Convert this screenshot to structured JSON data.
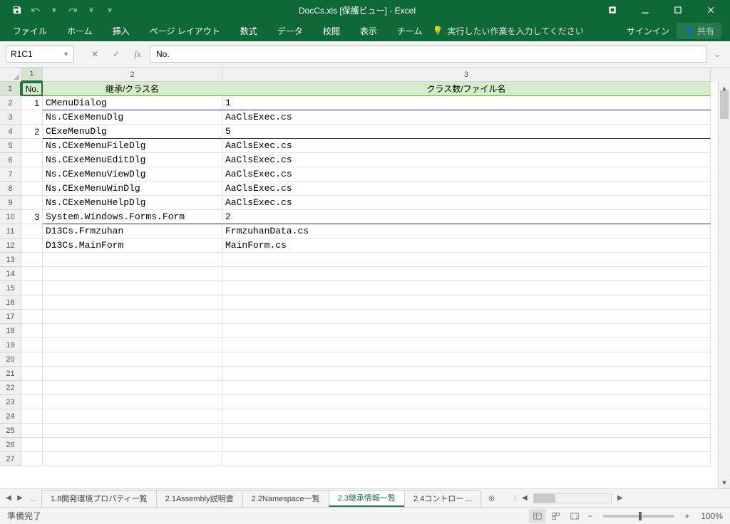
{
  "title": "DocCs.xls [保護ビュー] - Excel",
  "ribbon": {
    "file": "ファイル",
    "home": "ホーム",
    "insert": "挿入",
    "pagelayout": "ページ レイアウト",
    "formulas": "数式",
    "data": "データ",
    "review": "校閲",
    "view": "表示",
    "team": "チーム",
    "tellme": "実行したい作業を入力してください",
    "signin": "サインイン",
    "share": "共有"
  },
  "namebox": "R1C1",
  "formula": "No.",
  "col_headers": [
    "1",
    "2",
    "3"
  ],
  "table": {
    "header": {
      "no": "No.",
      "col2": "継承/クラス名",
      "col3": "クラス数/ファイル名"
    },
    "rows": [
      {
        "type": "group",
        "no": "1",
        "col2": "CMenuDialog",
        "col3": "1"
      },
      {
        "type": "item",
        "no": "",
        "col2": "Ns.CExeMenuDlg",
        "col3": "AaClsExec.cs"
      },
      {
        "type": "group",
        "no": "2",
        "col2": "CExeMenuDlg",
        "col3": "5"
      },
      {
        "type": "item",
        "no": "",
        "col2": "Ns.CExeMenuFileDlg",
        "col3": "AaClsExec.cs"
      },
      {
        "type": "item",
        "no": "",
        "col2": "Ns.CExeMenuEditDlg",
        "col3": "AaClsExec.cs"
      },
      {
        "type": "item",
        "no": "",
        "col2": "Ns.CExeMenuViewDlg",
        "col3": "AaClsExec.cs"
      },
      {
        "type": "item",
        "no": "",
        "col2": "Ns.CExeMenuWinDlg",
        "col3": "AaClsExec.cs"
      },
      {
        "type": "item",
        "no": "",
        "col2": "Ns.CExeMenuHelpDlg",
        "col3": "AaClsExec.cs"
      },
      {
        "type": "group",
        "no": "3",
        "col2": "System.Windows.Forms.Form",
        "col3": "2"
      },
      {
        "type": "item",
        "no": "",
        "col2": "D13Cs.Frmzuhan",
        "col3": "FrmzuhanData.cs"
      },
      {
        "type": "item",
        "no": "",
        "col2": "D13Cs.MainForm",
        "col3": "MainForm.cs"
      }
    ]
  },
  "sheet_tabs": {
    "t1": "1.8開発環境プロパティ一覧",
    "t2": "2.1Assembly説明書",
    "t3": "2.2Namespace一覧",
    "t4": "2.3継承情報一覧",
    "t5": "2.4コントロー ..."
  },
  "status": "準備完了",
  "zoom": "100%"
}
